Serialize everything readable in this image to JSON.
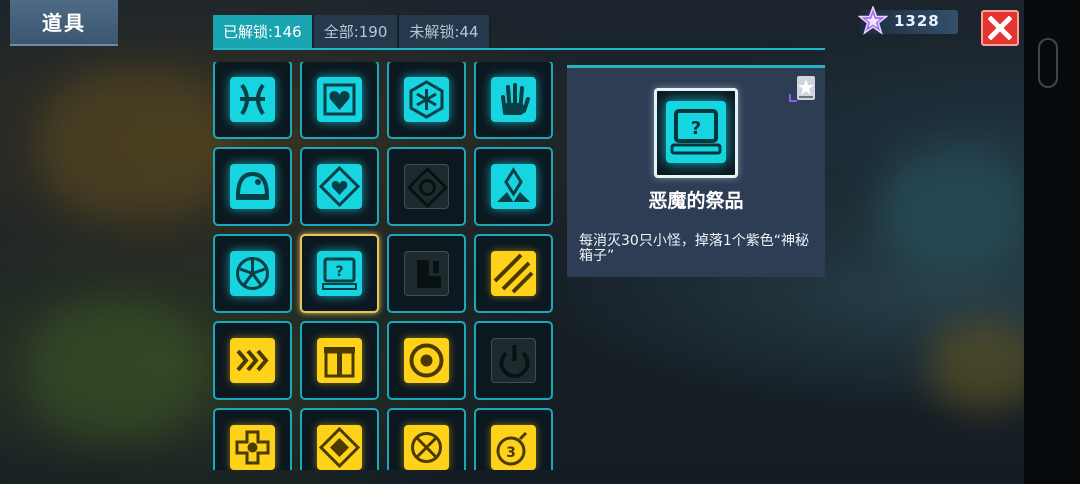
{
  "header": {
    "title": "道具"
  },
  "currency": {
    "value": "1328",
    "icon": "purple-star-gem-icon"
  },
  "tabs": [
    {
      "label": "已解锁:146",
      "active": true
    },
    {
      "label": "全部:190",
      "active": false
    },
    {
      "label": "未解锁:44",
      "active": false
    }
  ],
  "items": [
    {
      "icon": "pisces-icon",
      "color": "cyan",
      "selected": false
    },
    {
      "icon": "heart-shield-icon",
      "color": "cyan",
      "selected": false
    },
    {
      "icon": "snowflake-hexagon-icon",
      "color": "cyan",
      "selected": false
    },
    {
      "icon": "hand-icon",
      "color": "cyan",
      "selected": false
    },
    {
      "icon": "helmet-icon",
      "color": "cyan",
      "selected": false
    },
    {
      "icon": "heart-diamond-icon",
      "color": "cyan",
      "selected": false
    },
    {
      "icon": "heart-diamond-locked-icon",
      "color": "dark",
      "selected": false
    },
    {
      "icon": "crystal-burst-icon",
      "color": "cyan",
      "selected": false
    },
    {
      "icon": "fan-wheel-icon",
      "color": "cyan",
      "selected": false
    },
    {
      "icon": "mystery-box-icon",
      "color": "cyan",
      "selected": true
    },
    {
      "icon": "boot-locked-icon",
      "color": "dark",
      "selected": false
    },
    {
      "icon": "slash-stripes-icon",
      "color": "yellow",
      "selected": false
    },
    {
      "icon": "triple-chevron-icon",
      "color": "yellow",
      "selected": false
    },
    {
      "icon": "gift-box-icon",
      "color": "yellow",
      "selected": false
    },
    {
      "icon": "target-ring-icon",
      "color": "yellow",
      "selected": false
    },
    {
      "icon": "power-locked-icon",
      "color": "dark",
      "selected": false
    },
    {
      "icon": "gear-cross-icon",
      "color": "yellow",
      "selected": false
    },
    {
      "icon": "diamond-frame-icon",
      "color": "yellow",
      "selected": false
    },
    {
      "icon": "crosshair-shield-icon",
      "color": "yellow",
      "selected": false
    },
    {
      "icon": "bomb-icon",
      "color": "yellow",
      "selected": false
    }
  ],
  "detail": {
    "name": "恶魔的祭品",
    "description": "每消灭30只小怪，掉落1个紫色“神秘箱子”",
    "icon": "mystery-box-icon"
  },
  "colors": {
    "accent": "#1aa3b0",
    "cyan": "#16d4e0",
    "yellow": "#ffd21a",
    "close": "#e5352f",
    "panel": "#2c3d54"
  }
}
